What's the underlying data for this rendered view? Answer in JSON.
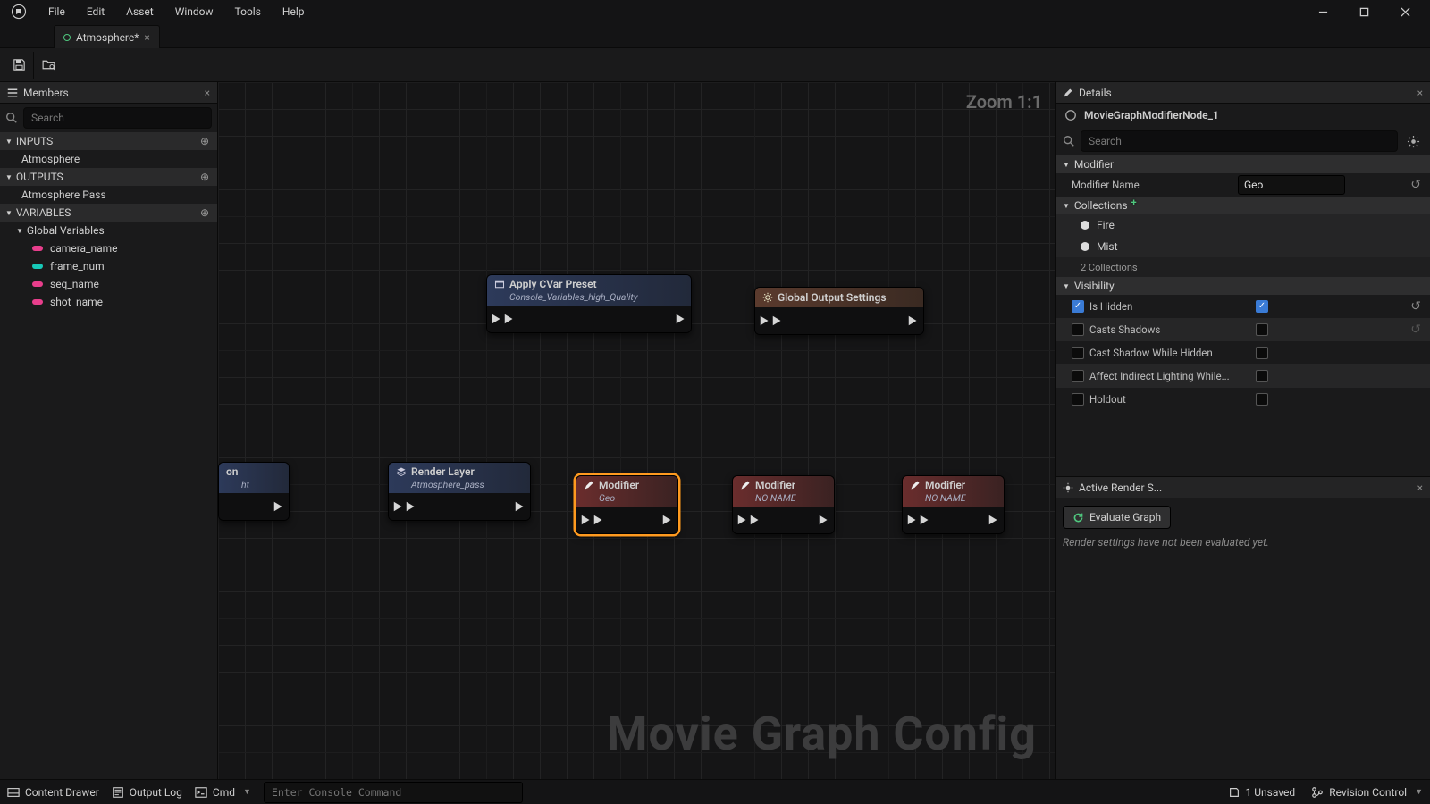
{
  "menu": {
    "file": "File",
    "edit": "Edit",
    "asset": "Asset",
    "window": "Window",
    "tools": "Tools",
    "help": "Help"
  },
  "tab": {
    "title": "Atmosphere*"
  },
  "members": {
    "title": "Members",
    "search_placeholder": "Search",
    "sections": {
      "inputs": {
        "label": "INPUTS",
        "items": [
          "Atmosphere"
        ]
      },
      "outputs": {
        "label": "OUTPUTS",
        "items": [
          "Atmosphere Pass"
        ]
      },
      "variables": {
        "label": "VARIABLES",
        "global_label": "Global Variables",
        "vars": [
          {
            "name": "camera_name",
            "color": "#e83e8c"
          },
          {
            "name": "frame_num",
            "color": "#17c9b8"
          },
          {
            "name": "seq_name",
            "color": "#e83e8c"
          },
          {
            "name": "shot_name",
            "color": "#e83e8c"
          }
        ]
      }
    }
  },
  "canvas": {
    "zoom": "Zoom 1:1",
    "watermark": "Movie Graph Config",
    "nodes": {
      "cvar": {
        "title": "Apply CVar Preset",
        "sub": "Console_Variables_high_Quality"
      },
      "gos": {
        "title": "Global Output Settings"
      },
      "frag": {
        "title": "on",
        "sub": "ht"
      },
      "render": {
        "title": "Render Layer",
        "sub": "Atmosphere_pass"
      },
      "mod1": {
        "title": "Modifier",
        "sub": "Geo"
      },
      "mod2": {
        "title": "Modifier",
        "sub": "NO NAME"
      },
      "mod3": {
        "title": "Modifier",
        "sub": "NO NAME"
      }
    }
  },
  "details": {
    "title": "Details",
    "object": "MovieGraphModifierNode_1",
    "search_placeholder": "Search",
    "modifier_section": "Modifier",
    "modifier_name_label": "Modifier Name",
    "modifier_name_value": "Geo",
    "collections_label": "Collections",
    "collections": [
      "Fire",
      "Mist"
    ],
    "collections_count": "2 Collections",
    "visibility_label": "Visibility",
    "vis": {
      "is_hidden": {
        "label": "Is Hidden",
        "override": true,
        "value": true
      },
      "casts_shadows": {
        "label": "Casts Shadows",
        "override": false,
        "value": false
      },
      "cast_hidden": {
        "label": "Cast Shadow While Hidden",
        "override": false,
        "value": false
      },
      "indirect": {
        "label": "Affect Indirect Lighting While...",
        "override": false,
        "value": false
      },
      "holdout": {
        "label": "Holdout",
        "override": false,
        "value": false
      }
    }
  },
  "ars": {
    "title": "Active Render S...",
    "button": "Evaluate Graph",
    "message": "Render settings have not been evaluated yet."
  },
  "status": {
    "content_drawer": "Content Drawer",
    "output_log": "Output Log",
    "cmd_label": "Cmd",
    "cmd_placeholder": "Enter Console Command",
    "unsaved": "1 Unsaved",
    "revision": "Revision Control"
  }
}
